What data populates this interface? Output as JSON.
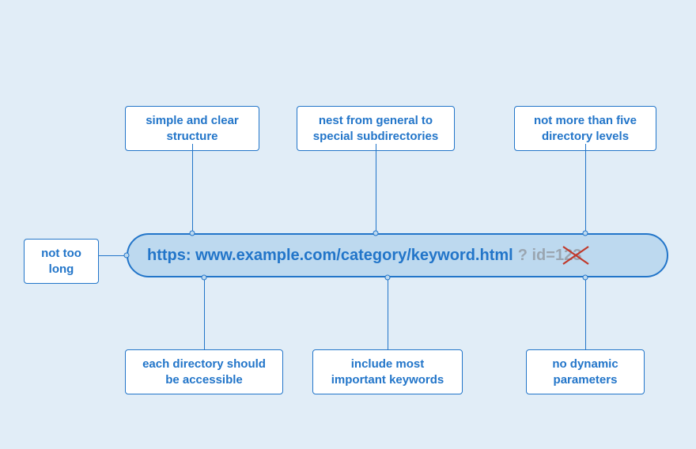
{
  "url": {
    "main": "https: www.example.com/category/keyword.html",
    "query": "? id=123"
  },
  "tips": {
    "left": "not too long",
    "top1": "simple and clear structure",
    "top2": "nest from general to special subdirectories",
    "top3": "not more than five directory levels",
    "bottom1": "each directory should be accessible",
    "bottom2": "include most important keywords",
    "bottom3": "no dynamic parameters"
  }
}
